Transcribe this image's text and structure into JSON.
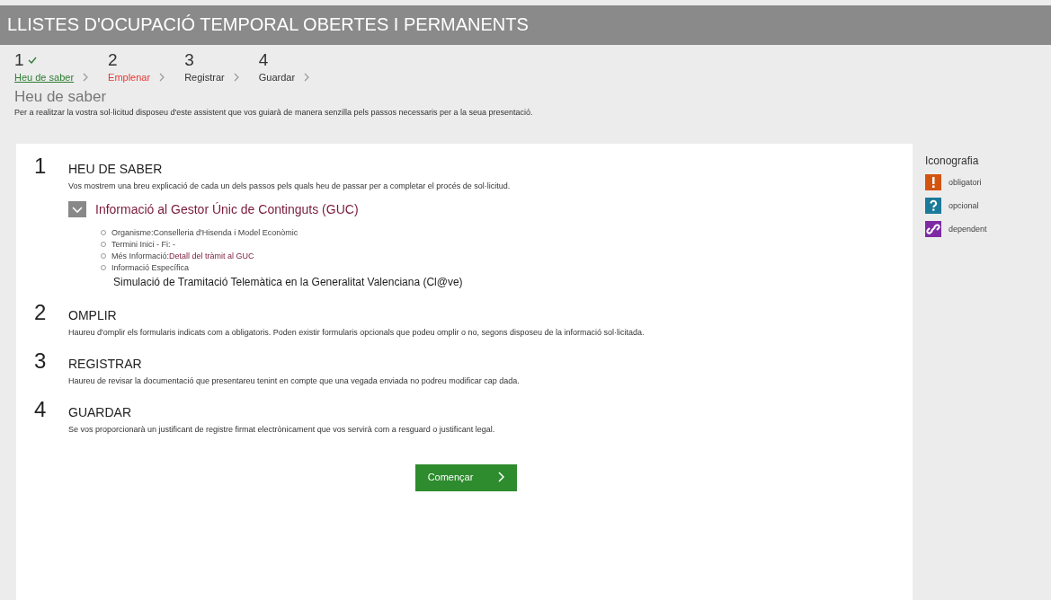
{
  "header": {
    "title": "LLISTES D'OCUPACIÓ TEMPORAL OBERTES I PERMANENTS"
  },
  "steps": [
    {
      "number": "1",
      "label": "Heu de saber",
      "done": true,
      "selected": false
    },
    {
      "number": "2",
      "label": "Emplenar",
      "done": false,
      "selected": true
    },
    {
      "number": "3",
      "label": "Registrar",
      "done": false,
      "selected": false
    },
    {
      "number": "4",
      "label": "Guardar",
      "done": false,
      "selected": false
    }
  ],
  "page": {
    "heading": "Heu de saber",
    "intro": "Per a realitzar la vostra sol·licitud disposeu d'este assistent que vos guiarà de manera senzilla pels passos necessaris per a la seua presentació."
  },
  "sections": [
    {
      "number": "1",
      "title": "HEU DE SABER",
      "text": "Vos mostrem una breu explicació de cada un dels passos pels quals heu de passar per a completar el procés de sol·licitud.",
      "info": {
        "title": "Informació al Gestor Únic de Continguts (GUC)",
        "expanded": true,
        "items": [
          {
            "label": "Organisme:Conselleria d'Hisenda i Model Econòmic"
          },
          {
            "label": "Termini Inici - Fi: -"
          },
          {
            "label": "Més Informació:",
            "link": "Detall del tràmit al GUC"
          },
          {
            "label": "Informació Específica"
          }
        ],
        "specific": "Simulació de Tramitació Telemàtica en la Generalitat Valenciana (Cl@ve)"
      }
    },
    {
      "number": "2",
      "title": "OMPLIR",
      "text": "Haureu d'omplir els formularis indicats com a obligatoris. Poden existir formularis opcionals que podeu omplir o no, segons disposeu de la informació sol·licitada."
    },
    {
      "number": "3",
      "title": "REGISTRAR",
      "text": "Haureu de revisar la documentació que presentareu tenint en compte que una vegada enviada no podreu modificar cap dada."
    },
    {
      "number": "4",
      "title": "GUARDAR",
      "text": "Se vos proporcionarà un justificant de registre firmat electrònicament que vos servirà com a resguard o justificant legal."
    }
  ],
  "start_button": {
    "label": "Començar"
  },
  "legend": {
    "title": "Iconografia",
    "items": [
      {
        "kind": "required",
        "label": "obligatori",
        "color": "#d3540f"
      },
      {
        "kind": "optional",
        "label": "opcional",
        "color": "#1b7a99"
      },
      {
        "kind": "dependent",
        "label": "dependent",
        "color": "#7e2ba3"
      }
    ]
  }
}
